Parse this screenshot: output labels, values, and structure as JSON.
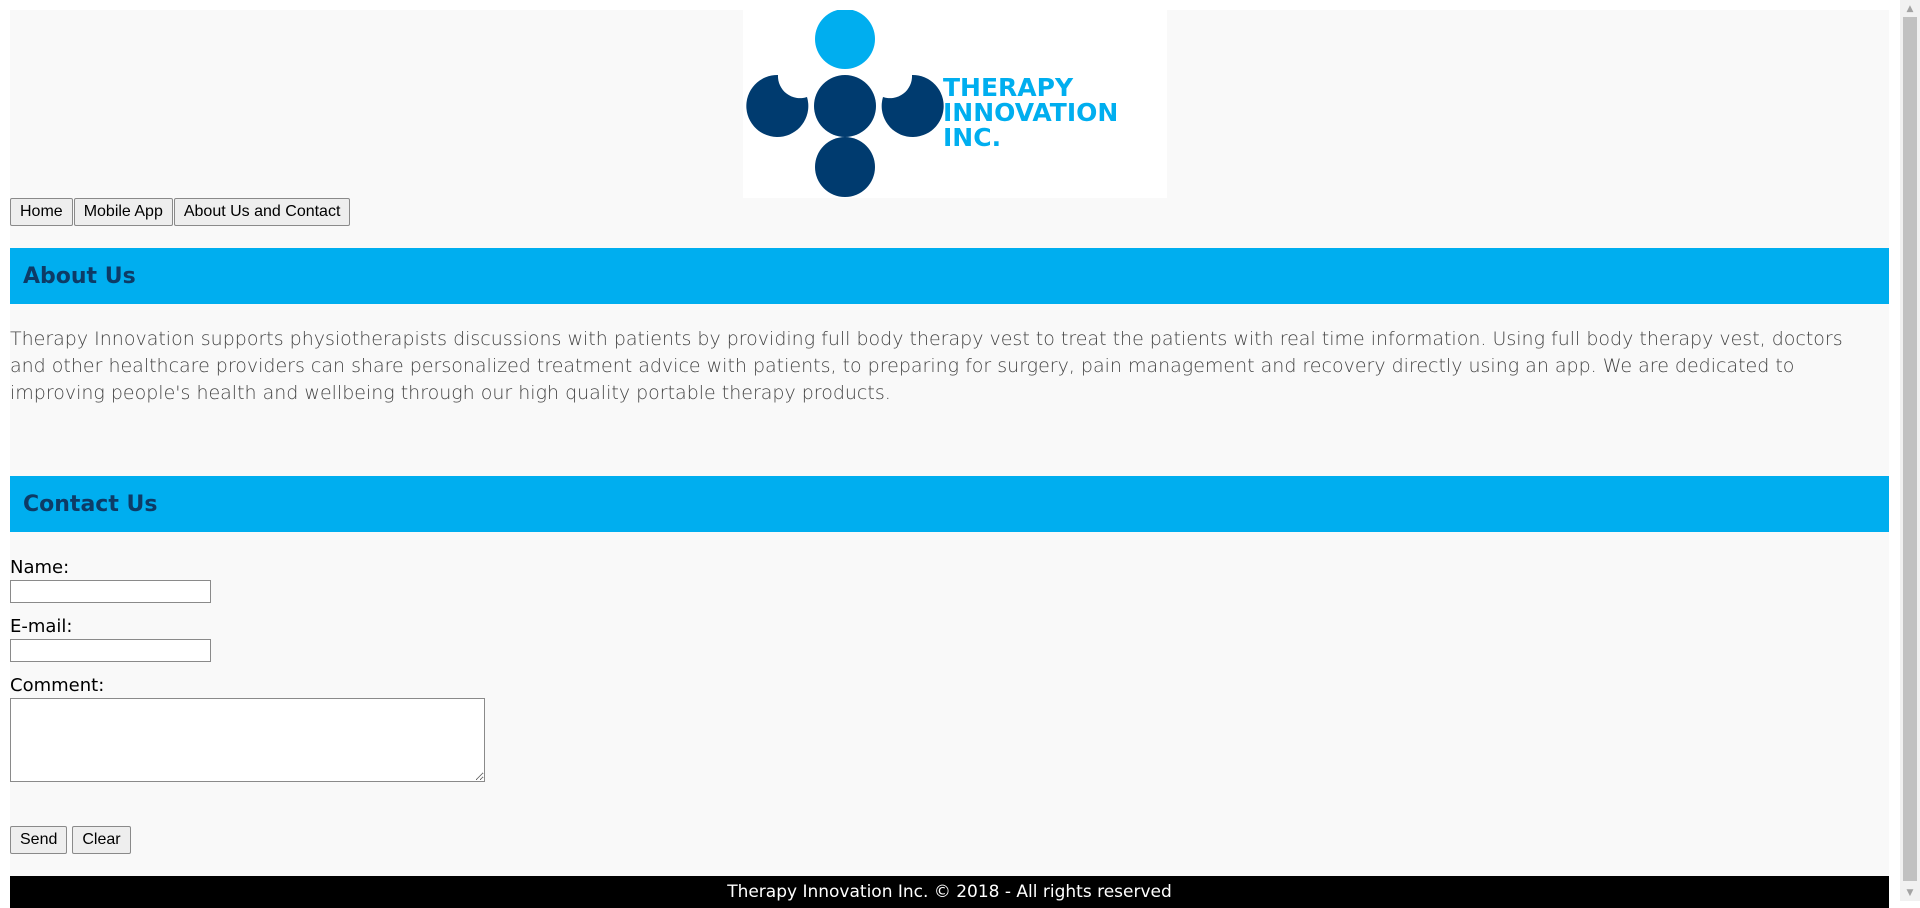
{
  "logo": {
    "line1": "THERAPY",
    "line2": "INNOVATION",
    "line3": "INC.",
    "colors": {
      "light_blue": "#00aeef",
      "dark_blue": "#003b6f"
    }
  },
  "nav": {
    "items": [
      {
        "label": "Home"
      },
      {
        "label": "Mobile App"
      },
      {
        "label": "About Us and Contact"
      }
    ]
  },
  "about": {
    "heading": "About Us",
    "text": "Therapy Innovation supports physiotherapists discussions with patients by providing full body therapy vest to treat the patients with real time information. Using full body therapy vest, doctors and other healthcare providers can share personalized treatment advice with patients, to preparing for surgery, pain management and recovery directly using an app. We are dedicated to improving people's health and wellbeing through our high quality portable therapy products."
  },
  "contact": {
    "heading": "Contact Us",
    "name_label": "Name:",
    "name_value": "",
    "email_label": "E-mail:",
    "email_value": "",
    "comment_label": "Comment:",
    "comment_value": "",
    "send_label": "Send",
    "clear_label": "Clear"
  },
  "footer": {
    "text": "Therapy Innovation Inc. © 2018 - All rights reserved"
  },
  "theme": {
    "header_bar": "#00aeef",
    "header_text": "#0d3b66",
    "footer_bg": "#000000"
  }
}
